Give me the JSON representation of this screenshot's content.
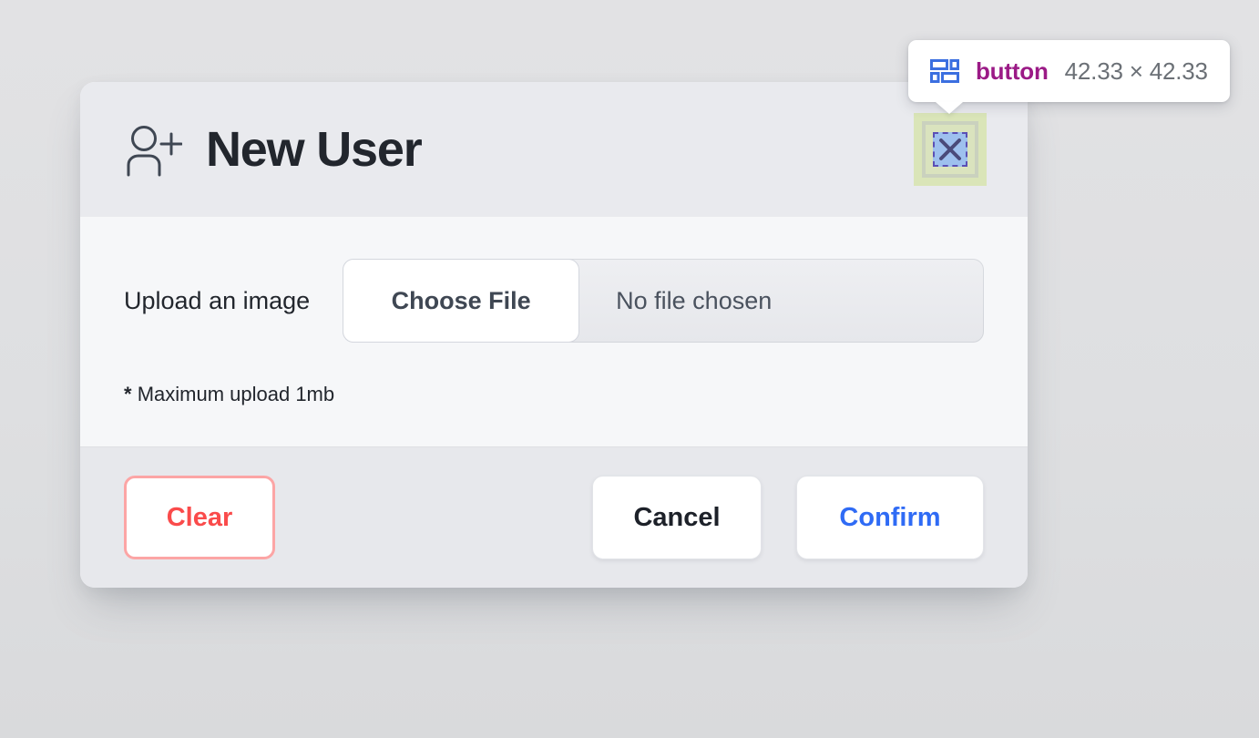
{
  "modal": {
    "header": {
      "title": "New User",
      "icon": "user-plus-icon",
      "close_icon": "close-x-icon"
    },
    "body": {
      "upload_label": "Upload an image",
      "file_input": {
        "button_label": "Choose File",
        "status_text": "No file chosen"
      },
      "note_marker": "*",
      "note_text": "Maximum upload 1mb"
    },
    "footer": {
      "clear_label": "Clear",
      "cancel_label": "Cancel",
      "confirm_label": "Confirm"
    }
  },
  "inspector": {
    "icon": "layout-grid-icon",
    "tag_name": "button",
    "dimensions": "42.33 × 42.33"
  },
  "colors": {
    "page_background": "#E0E1E3",
    "modal_header_bg": "#E9EAEE",
    "modal_body_bg": "#F6F7F9",
    "modal_footer_bg": "#E7E8EC",
    "title_text": "#22262D",
    "clear_text": "#FA4B4B",
    "clear_border": "#FCA5A5",
    "cancel_text": "#1D2129",
    "confirm_text": "#2F6BF5",
    "inspector_tag": "#9B1A86",
    "inspector_dims": "#6B7076",
    "inspector_icon": "#3B6FE0",
    "highlight_content": "#9EC0EE",
    "highlight_margin": "#D7E4B0",
    "highlight_border": "#5B4FB5"
  }
}
